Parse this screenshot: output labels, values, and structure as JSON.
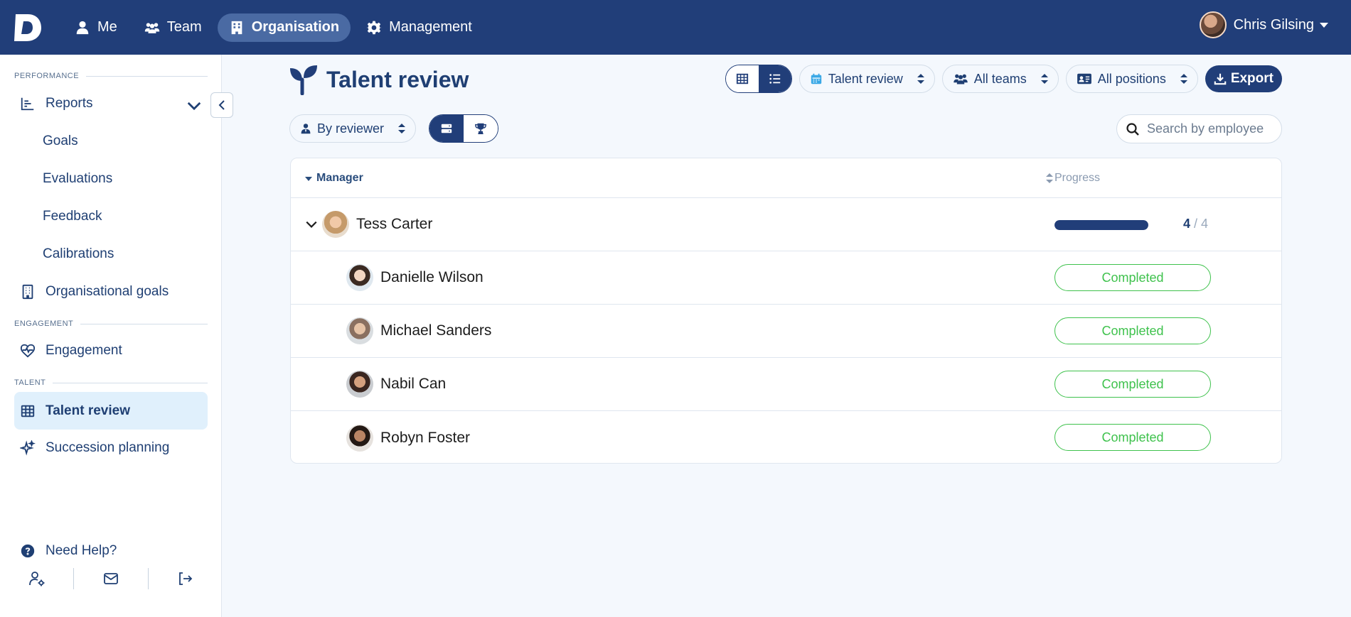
{
  "nav": {
    "items": [
      {
        "label": "Me",
        "icon": "user-icon",
        "active": false
      },
      {
        "label": "Team",
        "icon": "users-icon",
        "active": false
      },
      {
        "label": "Organisation",
        "icon": "building-icon",
        "active": true
      },
      {
        "label": "Management",
        "icon": "gear-icon",
        "active": false
      }
    ],
    "user_name": "Chris Gilsing"
  },
  "sidebar": {
    "sections": {
      "performance": "PERFORMANCE",
      "engagement": "ENGAGEMENT",
      "talent": "TALENT"
    },
    "items": {
      "reports": "Reports",
      "goals": "Goals",
      "evaluations": "Evaluations",
      "feedback": "Feedback",
      "calibrations": "Calibrations",
      "organisational_goals": "Organisational goals",
      "engagement": "Engagement",
      "talent_review": "Talent review",
      "succession_planning": "Succession planning"
    },
    "help": "Need Help?"
  },
  "page": {
    "title": "Talent review"
  },
  "toolbar": {
    "review_filter": "Talent review",
    "team_filter": "All teams",
    "position_filter": "All positions",
    "export_label": "Export"
  },
  "filters": {
    "group_by": "By reviewer",
    "search_placeholder": "Search by employee"
  },
  "table": {
    "columns": {
      "manager": "Manager",
      "progress": "Progress"
    },
    "manager": {
      "name": "Tess Carter",
      "progress_done": "4",
      "progress_total": "/ 4",
      "progress_fraction": 1.0
    },
    "rows": [
      {
        "name": "Danielle Wilson",
        "status": "Completed"
      },
      {
        "name": "Michael Sanders",
        "status": "Completed"
      },
      {
        "name": "Nabil Can",
        "status": "Completed"
      },
      {
        "name": "Robyn Foster",
        "status": "Completed"
      }
    ]
  },
  "colors": {
    "brand": "#213e79",
    "accent_light": "#e0f0fc",
    "success": "#3fc24d"
  }
}
